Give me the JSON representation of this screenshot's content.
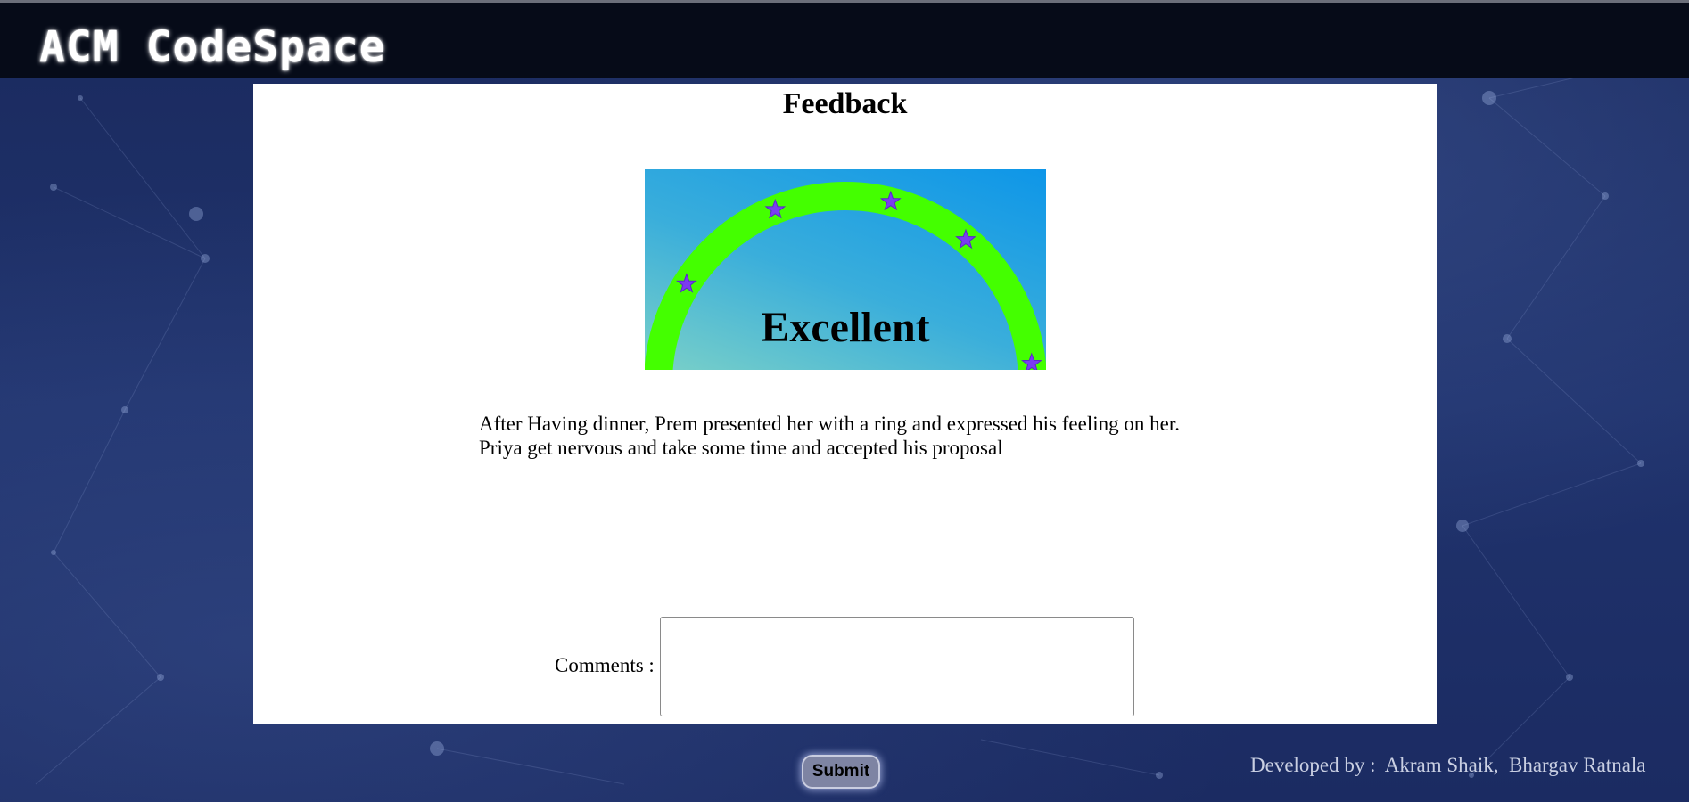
{
  "header": {
    "app_title": "ACM CodeSpace"
  },
  "feedback": {
    "title": "Feedback",
    "rating_label": "Excellent",
    "rating_stars": 5,
    "story_lines": [
      "After Having dinner, Prem presented her with a ring and expressed his feeling on her.",
      "Priya get nervous and take some time and accepted his proposal"
    ],
    "comments_label": "Comments :",
    "comments_value": "",
    "submit_label": "Submit"
  },
  "footer": {
    "credits": "Developed by :  Akram Shaik,  Bhargav Ratnala"
  },
  "colors": {
    "topbar": "#060b18",
    "arc": "#44ff00",
    "star": "#7b3cf0",
    "background": "#1e3068"
  }
}
